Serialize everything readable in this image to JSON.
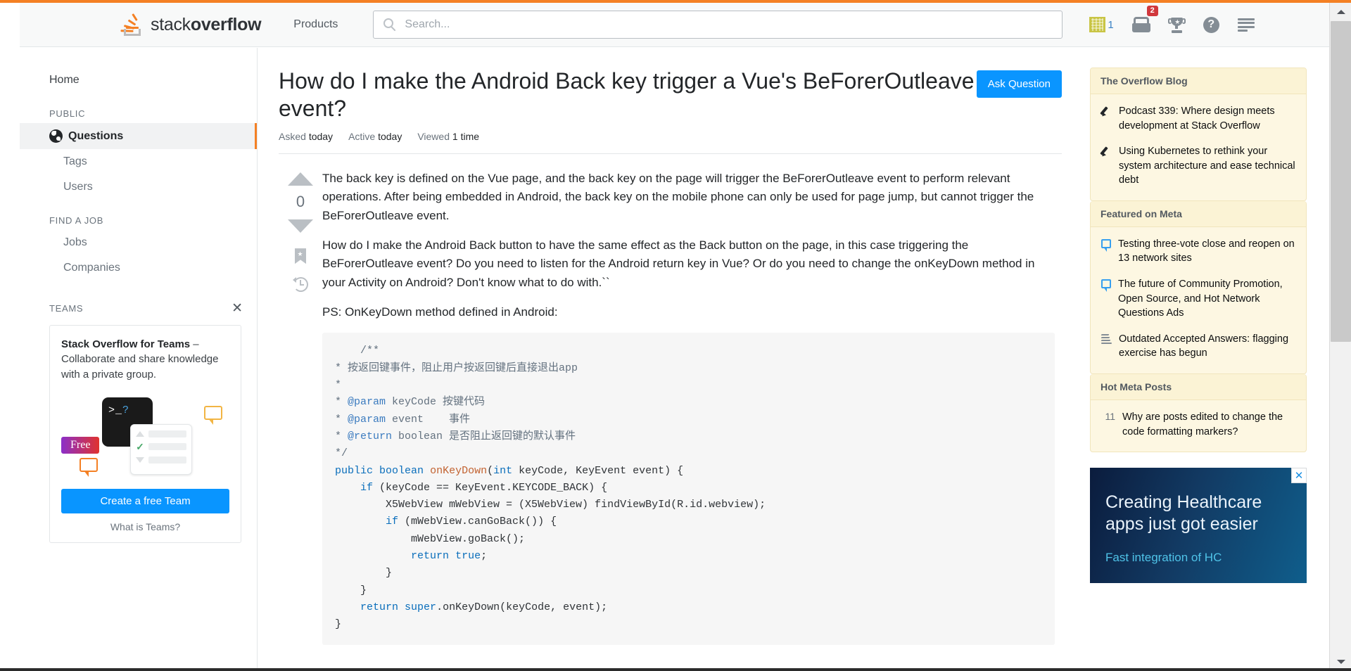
{
  "header": {
    "logo_stack": "stack",
    "logo_overflow": "overflow",
    "products_label": "Products",
    "search_placeholder": "Search...",
    "search_value": "",
    "search_icon": "search-icon",
    "achievements_count": "1",
    "inbox_badge": "2",
    "inbox_icon": "inbox-icon",
    "trophy_icon": "trophy-icon",
    "help_icon": "help-circle-icon",
    "mod_icon": "mod-inbox-icon"
  },
  "sidebar": {
    "home_label": "Home",
    "public_section": "PUBLIC",
    "questions_label": "Questions",
    "tags_label": "Tags",
    "users_label": "Users",
    "jobs_section": "FIND A JOB",
    "jobs_label": "Jobs",
    "companies_label": "Companies",
    "teams_section": "TEAMS",
    "teams_close": "✕",
    "teams_promo_bold": "Stack Overflow for Teams",
    "teams_promo_rest": " – Collaborate and share knowledge with a private group.",
    "teams_terminal_prompt": ">_",
    "teams_terminal_q": "?",
    "teams_free_badge": "Free",
    "teams_button": "Create a free Team",
    "teams_what_link": "What is Teams?"
  },
  "question": {
    "title": "How do I make the Android Back key trigger a Vue's BeForerOutleave event?",
    "ask_button": "Ask Question",
    "meta": {
      "asked_label": "Asked",
      "asked_value": "today",
      "active_label": "Active",
      "active_value": "today",
      "viewed_label": "Viewed",
      "viewed_value": "1 time"
    },
    "vote_count": "0",
    "paragraph_1": "The back key is defined on the Vue page, and the back key on the page will trigger the BeForerOutleave event to perform relevant operations. After being embedded in Android, the back key on the mobile phone can only be used for page jump, but cannot trigger the BeForerOutleave event.",
    "paragraph_2": "How do I make the Android Back button to have the same effect as the Back button on the page, in this case triggering the BeForerOutleave event? Do you need to listen for the Android return key in Vue? Or do you need to change the onKeyDown method in your Activity on Android? Don't know what to do with.``",
    "paragraph_3": "PS: OnKeyDown method defined in Android:",
    "code_lines": [
      "    /**",
      "* 按返回键事件，阻止用户按返回键后直接退出pp",
      "*",
      "* @param keyCode 按键代码",
      "* @param event    事件",
      "* @return boolean 是否阻止返回键的默认事件",
      "*/",
      "public boolean onKeyDown(int keyCode, KeyEvent event) {",
      "    if (keyCode == KeyEvent.KEYCODE_BACK) {",
      "        X5WebView mWebView = (X5WebView) findViewById(R.id.webview);",
      "        if (mWebView.canGoBack()) {",
      "            mWebView.goBack();",
      "            return true;",
      "        }",
      "    }",
      "    return super.onKeyDown(keyCode, event);",
      "}"
    ]
  },
  "rail": {
    "blog": {
      "title": "The Overflow Blog",
      "items": [
        "Podcast 339: Where design meets development at Stack Overflow",
        "Using Kubernetes to rethink your system architecture and ease technical debt"
      ]
    },
    "meta": {
      "title": "Featured on Meta",
      "items": [
        {
          "icon": "speech-bubble-icon",
          "text": "Testing three-vote close and reopen on 13 network sites"
        },
        {
          "icon": "speech-bubble-icon",
          "text": "The future of Community Promotion, Open Source, and Hot Network Questions Ads"
        },
        {
          "icon": "stack-icon",
          "text": "Outdated Accepted Answers: flagging exercise has begun"
        }
      ]
    },
    "hot": {
      "title": "Hot Meta Posts",
      "items": [
        {
          "score": "11",
          "text": "Why are posts edited to change the code formatting markers?"
        }
      ]
    },
    "ad": {
      "title": "Creating Healthcare apps just got easier",
      "subtitle": "Fast integration of HC",
      "close": "✕"
    }
  },
  "colors": {
    "accent_orange": "#f48024",
    "link_blue": "#0a95ff",
    "rail_bg": "#fdf7e2"
  }
}
